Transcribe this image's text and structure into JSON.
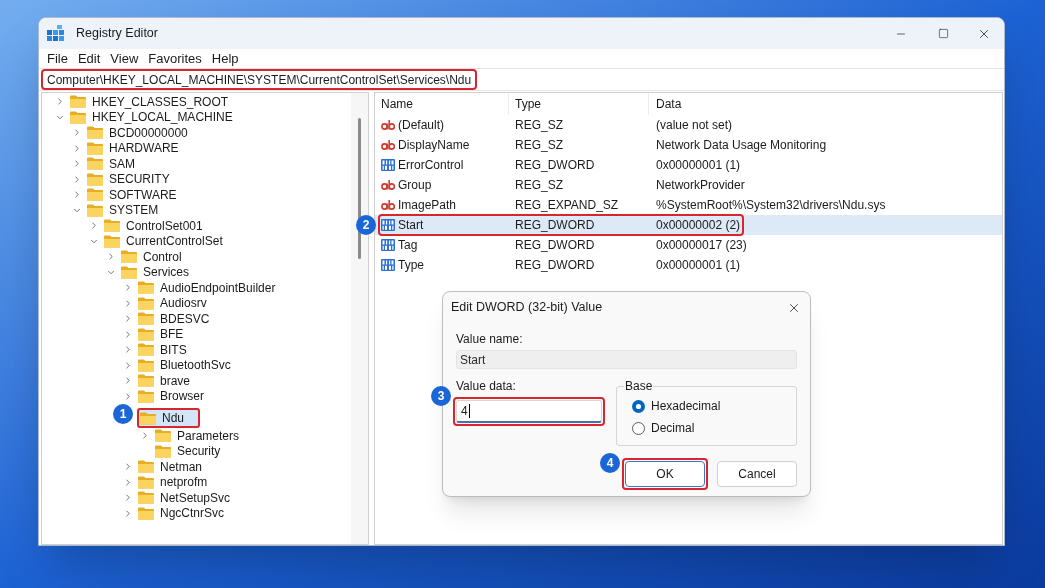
{
  "window": {
    "title": "Registry Editor"
  },
  "menu": [
    "File",
    "Edit",
    "View",
    "Favorites",
    "Help"
  ],
  "address_bar": {
    "path": "Computer\\HKEY_LOCAL_MACHINE\\SYSTEM\\CurrentControlSet\\Services\\Ndu",
    "highlighted": true
  },
  "tree": [
    {
      "label": "HKEY_CLASSES_ROOT",
      "expanded": false,
      "selected": false
    },
    {
      "label": "HKEY_LOCAL_MACHINE",
      "expanded": true,
      "selected": false,
      "children": [
        {
          "label": "BCD00000000",
          "expanded": false,
          "selected": false
        },
        {
          "label": "HARDWARE",
          "expanded": false,
          "selected": false
        },
        {
          "label": "SAM",
          "expanded": false,
          "selected": false
        },
        {
          "label": "SECURITY",
          "expanded": false,
          "selected": false
        },
        {
          "label": "SOFTWARE",
          "expanded": false,
          "selected": false
        },
        {
          "label": "SYSTEM",
          "expanded": true,
          "selected": false,
          "children": [
            {
              "label": "ControlSet001",
              "expanded": false,
              "selected": false
            },
            {
              "label": "CurrentControlSet",
              "expanded": true,
              "selected": false,
              "children": [
                {
                  "label": "Control",
                  "expanded": false,
                  "selected": false
                },
                {
                  "label": "Services",
                  "expanded": true,
                  "selected": false,
                  "children": [
                    {
                      "label": "AudioEndpointBuilder",
                      "expanded": false,
                      "selected": false
                    },
                    {
                      "label": "Audiosrv",
                      "expanded": false,
                      "selected": false
                    },
                    {
                      "label": "BDESVC",
                      "expanded": false,
                      "selected": false
                    },
                    {
                      "label": "BFE",
                      "expanded": false,
                      "selected": false
                    },
                    {
                      "label": "BITS",
                      "expanded": false,
                      "selected": false
                    },
                    {
                      "label": "BluetoothSvc",
                      "expanded": false,
                      "selected": false
                    },
                    {
                      "label": "brave",
                      "expanded": false,
                      "selected": false
                    },
                    {
                      "label": "Browser",
                      "expanded": false,
                      "selected": false
                    },
                    {
                      "label": "Ndu",
                      "expanded": true,
                      "selected": true,
                      "callout": "1",
                      "children": [
                        {
                          "label": "Parameters",
                          "expanded": false,
                          "selected": false
                        },
                        {
                          "label": "Security",
                          "selected": false,
                          "leaf": true
                        }
                      ]
                    },
                    {
                      "label": "Netman",
                      "expanded": false,
                      "selected": false
                    },
                    {
                      "label": "netprofm",
                      "expanded": false,
                      "selected": false
                    },
                    {
                      "label": "NetSetupSvc",
                      "expanded": false,
                      "selected": false
                    },
                    {
                      "label": "NgcCtnrSvc",
                      "expanded": false,
                      "selected": false
                    }
                  ]
                }
              ]
            }
          ]
        }
      ]
    }
  ],
  "values": {
    "columns": [
      "Name",
      "Type",
      "Data"
    ],
    "rows": [
      {
        "name": "(Default)",
        "type": "REG_SZ",
        "data": "(value not set)",
        "kind": "string",
        "selected": false
      },
      {
        "name": "DisplayName",
        "type": "REG_SZ",
        "data": "Network Data Usage Monitoring",
        "kind": "string",
        "selected": false
      },
      {
        "name": "ErrorControl",
        "type": "REG_DWORD",
        "data": "0x00000001 (1)",
        "kind": "dword",
        "selected": false
      },
      {
        "name": "Group",
        "type": "REG_SZ",
        "data": "NetworkProvider",
        "kind": "string",
        "selected": false
      },
      {
        "name": "ImagePath",
        "type": "REG_EXPAND_SZ",
        "data": "%SystemRoot%\\System32\\drivers\\Ndu.sys",
        "kind": "string",
        "selected": false
      },
      {
        "name": "Start",
        "type": "REG_DWORD",
        "data": "0x00000002 (2)",
        "kind": "dword",
        "selected": true,
        "callout": "2"
      },
      {
        "name": "Tag",
        "type": "REG_DWORD",
        "data": "0x00000017 (23)",
        "kind": "dword",
        "selected": false
      },
      {
        "name": "Type",
        "type": "REG_DWORD",
        "data": "0x00000001 (1)",
        "kind": "dword",
        "selected": false
      }
    ]
  },
  "dialog": {
    "title": "Edit DWORD (32-bit) Value",
    "value_name": {
      "label": "Value name:",
      "value": "Start",
      "disabled": true
    },
    "value_data": {
      "label": "Value data:",
      "value": "4",
      "focused": true,
      "callout": "3"
    },
    "base": {
      "label": "Base",
      "options": [
        {
          "label": "Hexadecimal",
          "selected": true
        },
        {
          "label": "Decimal",
          "selected": false
        }
      ]
    },
    "buttons": [
      {
        "label": "OK",
        "default": true,
        "callout": "4"
      },
      {
        "label": "Cancel",
        "default": false
      }
    ]
  }
}
